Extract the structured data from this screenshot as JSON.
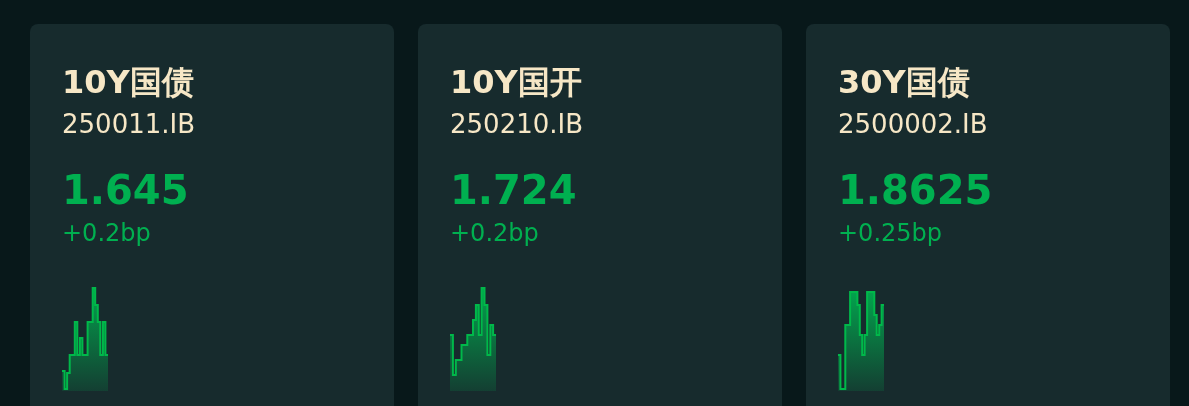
{
  "cards": [
    {
      "name": "10Y国债",
      "code": "250011.IB",
      "yield": "1.645",
      "change": "+0.2bp"
    },
    {
      "name": "10Y国开",
      "code": "250210.IB",
      "yield": "1.724",
      "change": "+0.2bp"
    },
    {
      "name": "30Y国债",
      "code": "2500002.IB",
      "yield": "1.8625",
      "change": "+0.25bp"
    }
  ]
}
